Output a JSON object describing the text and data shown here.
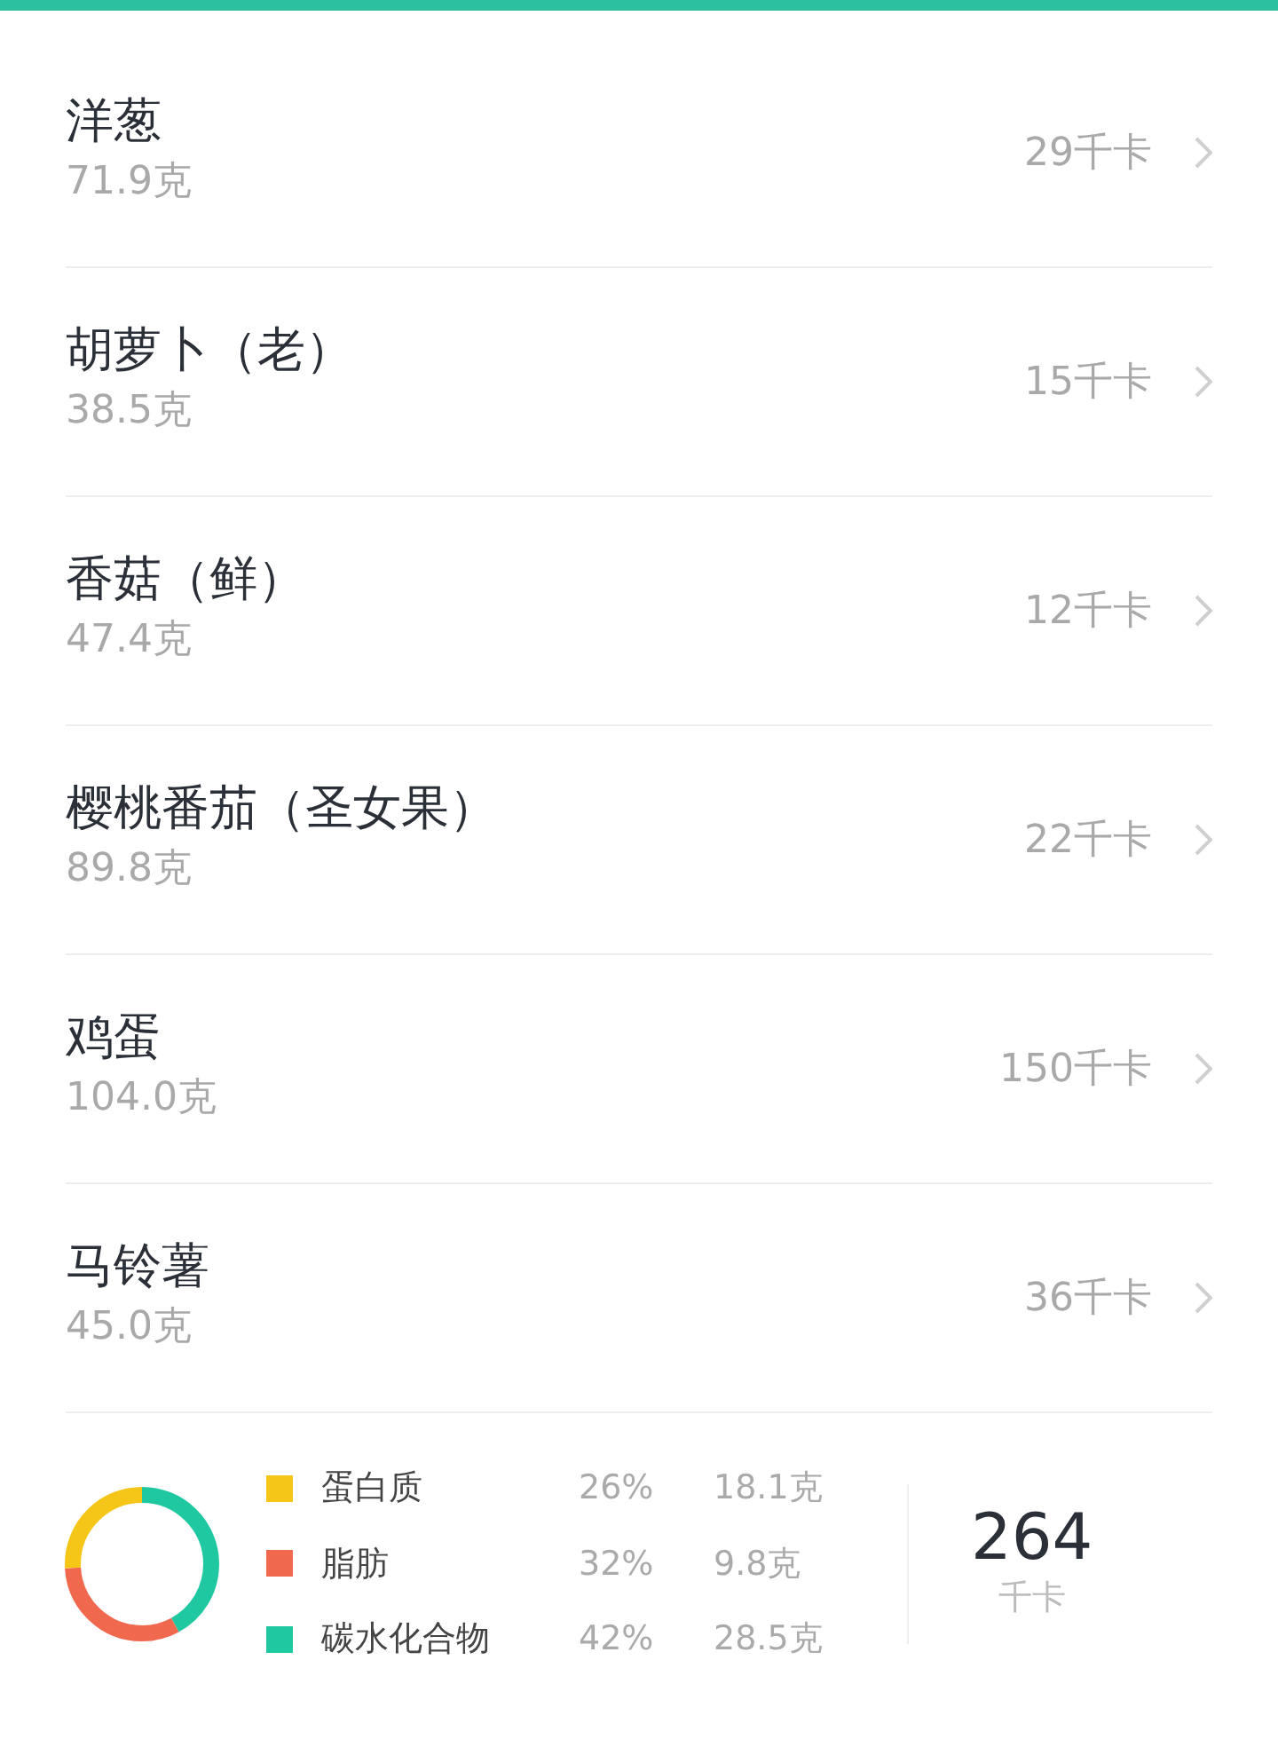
{
  "foods": [
    {
      "name": "洋葱",
      "weight": "71.9克",
      "calories": "29千卡"
    },
    {
      "name": "胡萝卜（老）",
      "weight": "38.5克",
      "calories": "15千卡"
    },
    {
      "name": "香菇（鲜）",
      "weight": "47.4克",
      "calories": "12千卡"
    },
    {
      "name": "樱桃番茄（圣女果）",
      "weight": "89.8克",
      "calories": "22千卡"
    },
    {
      "name": "鸡蛋",
      "weight": "104.0克",
      "calories": "150千卡"
    },
    {
      "name": "马铃薯",
      "weight": "45.0克",
      "calories": "36千卡"
    }
  ],
  "nutrients": [
    {
      "name": "蛋白质",
      "color": "#f5c518",
      "percent": "26%",
      "weight": "18.1克"
    },
    {
      "name": "脂肪",
      "color": "#f0684e",
      "percent": "32%",
      "weight": "9.8克"
    },
    {
      "name": "碳水化合物",
      "color": "#1fc8a0",
      "percent": "42%",
      "weight": "28.5克"
    }
  ],
  "total": {
    "value": "264",
    "unit": "千卡"
  }
}
